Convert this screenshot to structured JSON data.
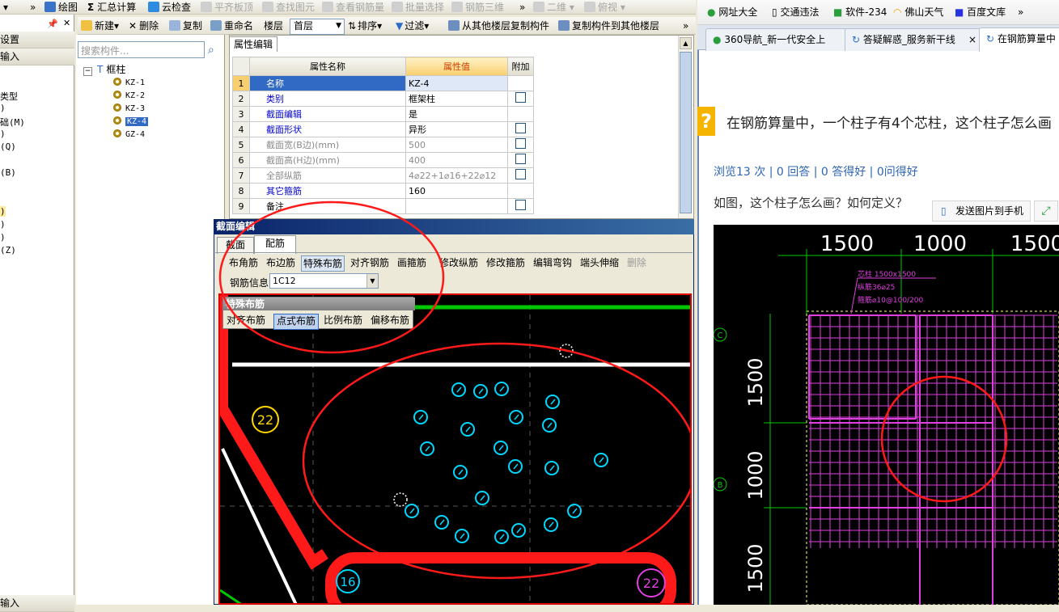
{
  "app": {
    "toolbar1": {
      "items": [
        "绘图",
        "汇总计算",
        "云检查",
        "平齐板顶",
        "查找图元",
        "查看钢筋量",
        "批量选择",
        "钢筋三维",
        "二维",
        "俯视"
      ]
    },
    "toolbar2": {
      "new": "新建",
      "delete": "删除",
      "copy": "复制",
      "rename": "重命名",
      "floor_label": "楼层",
      "floor_value": "首层",
      "sort": "排序",
      "filter": "过滤",
      "copy_from_floor": "从其他楼层复制构件",
      "copy_to_floor": "复制构件到其他楼层"
    },
    "left_pane": {
      "header1": "设置",
      "header2": "输入",
      "items": [
        "类型",
        ")",
        "础(M)",
        ")",
        "(Q)",
        "(B)",
        ")",
        ")",
        ")",
        "(Z)"
      ],
      "footer": "输入"
    },
    "tree": {
      "search_placeholder": "搜索构件...",
      "root": "框柱",
      "items": [
        "KZ-1",
        "KZ-2",
        "KZ-3",
        "KZ-4",
        "GZ-4"
      ],
      "selected": "KZ-4"
    },
    "property_editor": {
      "tab": "属性编辑",
      "columns": [
        "属性名称",
        "属性值",
        "附加"
      ],
      "rows": [
        {
          "n": "1",
          "name": "名称",
          "value": "KZ-4",
          "extra": false
        },
        {
          "n": "2",
          "name": "类别",
          "value": "框架柱",
          "extra": true
        },
        {
          "n": "3",
          "name": "截面编辑",
          "value": "是",
          "extra": false
        },
        {
          "n": "4",
          "name": "截面形状",
          "value": "异形",
          "extra": true
        },
        {
          "n": "5",
          "name": "截面宽(B边)(mm)",
          "value": "500",
          "extra": true
        },
        {
          "n": "6",
          "name": "截面高(H边)(mm)",
          "value": "400",
          "extra": true
        },
        {
          "n": "7",
          "name": "全部纵筋",
          "value": "4⌀22+1⌀16+22⌀12",
          "extra": true
        },
        {
          "n": "8",
          "name": "其它箍筋",
          "value": "160",
          "extra": false
        },
        {
          "n": "9",
          "name": "备注",
          "value": "",
          "extra": true
        }
      ]
    },
    "section_editor": {
      "title": "截面编辑",
      "tabs": [
        "截面",
        "配筋"
      ],
      "active_tab": "配筋",
      "tools": [
        "布角筋",
        "布边筋",
        "特殊布筋",
        "对齐钢筋",
        "画箍筋",
        "修改纵筋",
        "修改箍筋",
        "编辑弯钩",
        "端头伸缩",
        "删除"
      ],
      "active_tool": "特殊布筋",
      "rebar_info_label": "钢筋信息",
      "rebar_info_value": "1C12",
      "special_popup": {
        "title": "特殊布筋",
        "options": [
          "对齐布筋",
          "点式布筋",
          "比例布筋",
          "偏移布筋"
        ],
        "active": "点式布筋"
      },
      "bar_labels": [
        "22",
        "16",
        "22"
      ]
    }
  },
  "browser": {
    "bookmarks": [
      "网址大全",
      "交通违法",
      "软件-234",
      "佛山天气",
      "百度文库"
    ],
    "tabs": [
      "360导航_新一代安全上",
      "答疑解惑_服务新干线",
      "在钢筋算量中"
    ],
    "question_title": "在钢筋算量中，一个柱子有4个芯柱，这个柱子怎么画",
    "stats": "浏览13 次 | 0 回答 | 0 答得好 | 0问得好",
    "body": "如图，这个柱子怎么画？如何定义？",
    "send_button": "发送图片到手机",
    "drawing": {
      "top_dims": [
        "1500",
        "1000",
        "1500"
      ],
      "side_dims": [
        "1500",
        "1000",
        "1500"
      ],
      "notes": [
        "芯柱 1500x1500",
        "纵筋36⌀25",
        "箍筋⌀10@100/200"
      ],
      "grid_labels": [
        "C",
        "B"
      ]
    }
  },
  "colors": {
    "accent_red": "#ff1a1a",
    "cyan": "#00d8ff",
    "magenta": "#e040e0",
    "cad_green": "#00c800"
  }
}
